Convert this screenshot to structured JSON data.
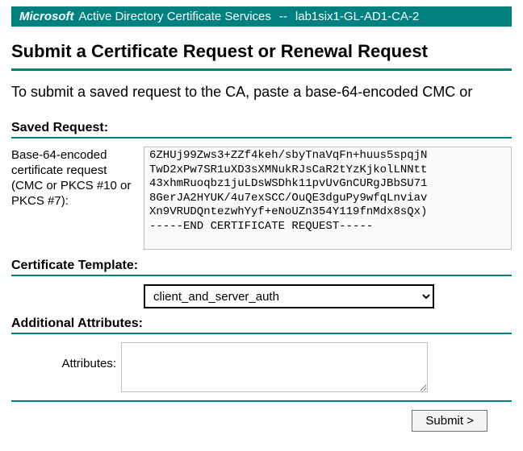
{
  "banner": {
    "product": "Microsoft",
    "service": "Active Directory Certificate Services",
    "separator": "--",
    "ca_name": "lab1six1-GL-AD1-CA-2"
  },
  "heading": "Submit a Certificate Request or Renewal Request",
  "intro": "To submit a saved request to the CA, paste a base-64-encoded CMC or",
  "saved": {
    "section_label": "Saved Request:",
    "left_label": "Base-64-encoded certificate request (CMC or PKCS #10 or PKCS #7):",
    "value": "6ZHUj99Zws3+ZZf4keh/sbyTnaVqFn+huus5spqjN\nTwD2xPw7SR1uXD3sXMNukRJsCaR2tYzKjkolLNNtt\n43xhmRuoqbz1juLDsWSDhk11pvUvGnCURgJBbSU71\n8GerJA2HYUK/4u7exSCC/OuQE3dguPy9wfqLnviav\nXn9VRUDQntezwhYyf+eNoUZn354Y119fnMdx8sQx)\n-----END CERTIFICATE REQUEST-----"
  },
  "template": {
    "section_label": "Certificate Template:",
    "selected": "client_and_server_auth"
  },
  "attributes": {
    "section_label": "Additional Attributes:",
    "left_label": "Attributes:",
    "value": ""
  },
  "submit_label": "Submit >"
}
